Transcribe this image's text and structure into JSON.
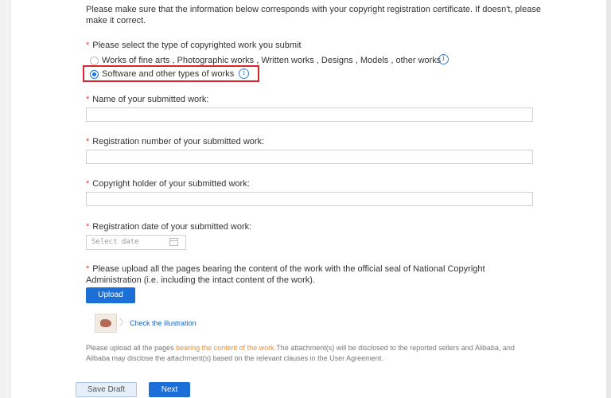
{
  "intro": {
    "line1": "Please make sure that the information below corresponds with your copyright registration certificate. If doesn't, please",
    "line2": "make it correct."
  },
  "work_type": {
    "asterisk": "*",
    "label": "Please select the type of copyrighted work you submit",
    "options": [
      {
        "label": "Works of fine arts , Photographic works , Written works , Designs , Models , other works",
        "selected": false
      },
      {
        "label": "Software and other types of works",
        "selected": true
      }
    ],
    "info_glyph": "i"
  },
  "fields": {
    "asterisk": "*",
    "name_label": "Name of your submitted work:",
    "registration_number_label": "Registration number of your submitted work:",
    "copyright_holder_label": "Copyright holder of your submitted work:",
    "registration_date_label": "Registration date of your submitted work:",
    "date_placeholder": "Select date"
  },
  "upload": {
    "asterisk": "*",
    "label_line1": "Please upload all the pages bearing the content of the work with the official seal of National Copyright",
    "label_line2": "Administration (i.e. including the intact content of the work).",
    "button": "Upload",
    "illustration_link": "Check the illustration",
    "note_prefix": "Please upload all the pages ",
    "note_highlight": "bearing the content of the work",
    "note_suffix": ".The attachment(s) will be disclosed to the reported sellers and Alibaba, and",
    "note_line2": "Alibaba may disclose the attachment(s) based on the relevant clauses in the User Agreement."
  },
  "actions": {
    "save_draft": "Save Draft",
    "next": "Next"
  },
  "colors": {
    "primary": "#1d6fd8",
    "required": "#e5412d",
    "highlight_box": "#d9262e",
    "link": "#1a66c2",
    "note_highlight": "#f08a24"
  }
}
